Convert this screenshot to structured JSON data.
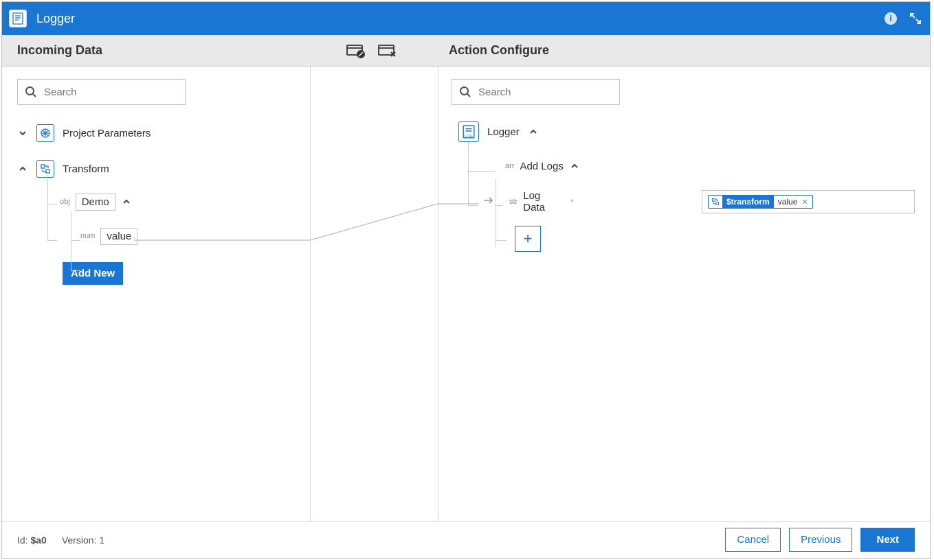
{
  "header": {
    "title": "Logger"
  },
  "subheader": {
    "left_title": "Incoming Data",
    "right_title": "Action Configure"
  },
  "left": {
    "search_placeholder": "Search",
    "tree": {
      "project_params_label": "Project Parameters",
      "transform_label": "Transform",
      "obj_type": "obj",
      "demo_label": "Demo",
      "num_type": "num",
      "value_label": "value",
      "add_new_label": "Add New"
    }
  },
  "right": {
    "search_placeholder": "Search",
    "logger_label": "Logger",
    "arr_type": "arr",
    "add_logs_label": "Add Logs",
    "str_type": "str",
    "log_data_label": "Log Data",
    "log_data_required": "*",
    "pill_dark": "$transform",
    "pill_light": "value"
  },
  "footer": {
    "id_label": "Id: ",
    "id_value": "$a0",
    "version_label": "Version: ",
    "version_value": "1",
    "cancel": "Cancel",
    "previous": "Previous",
    "next": "Next"
  }
}
